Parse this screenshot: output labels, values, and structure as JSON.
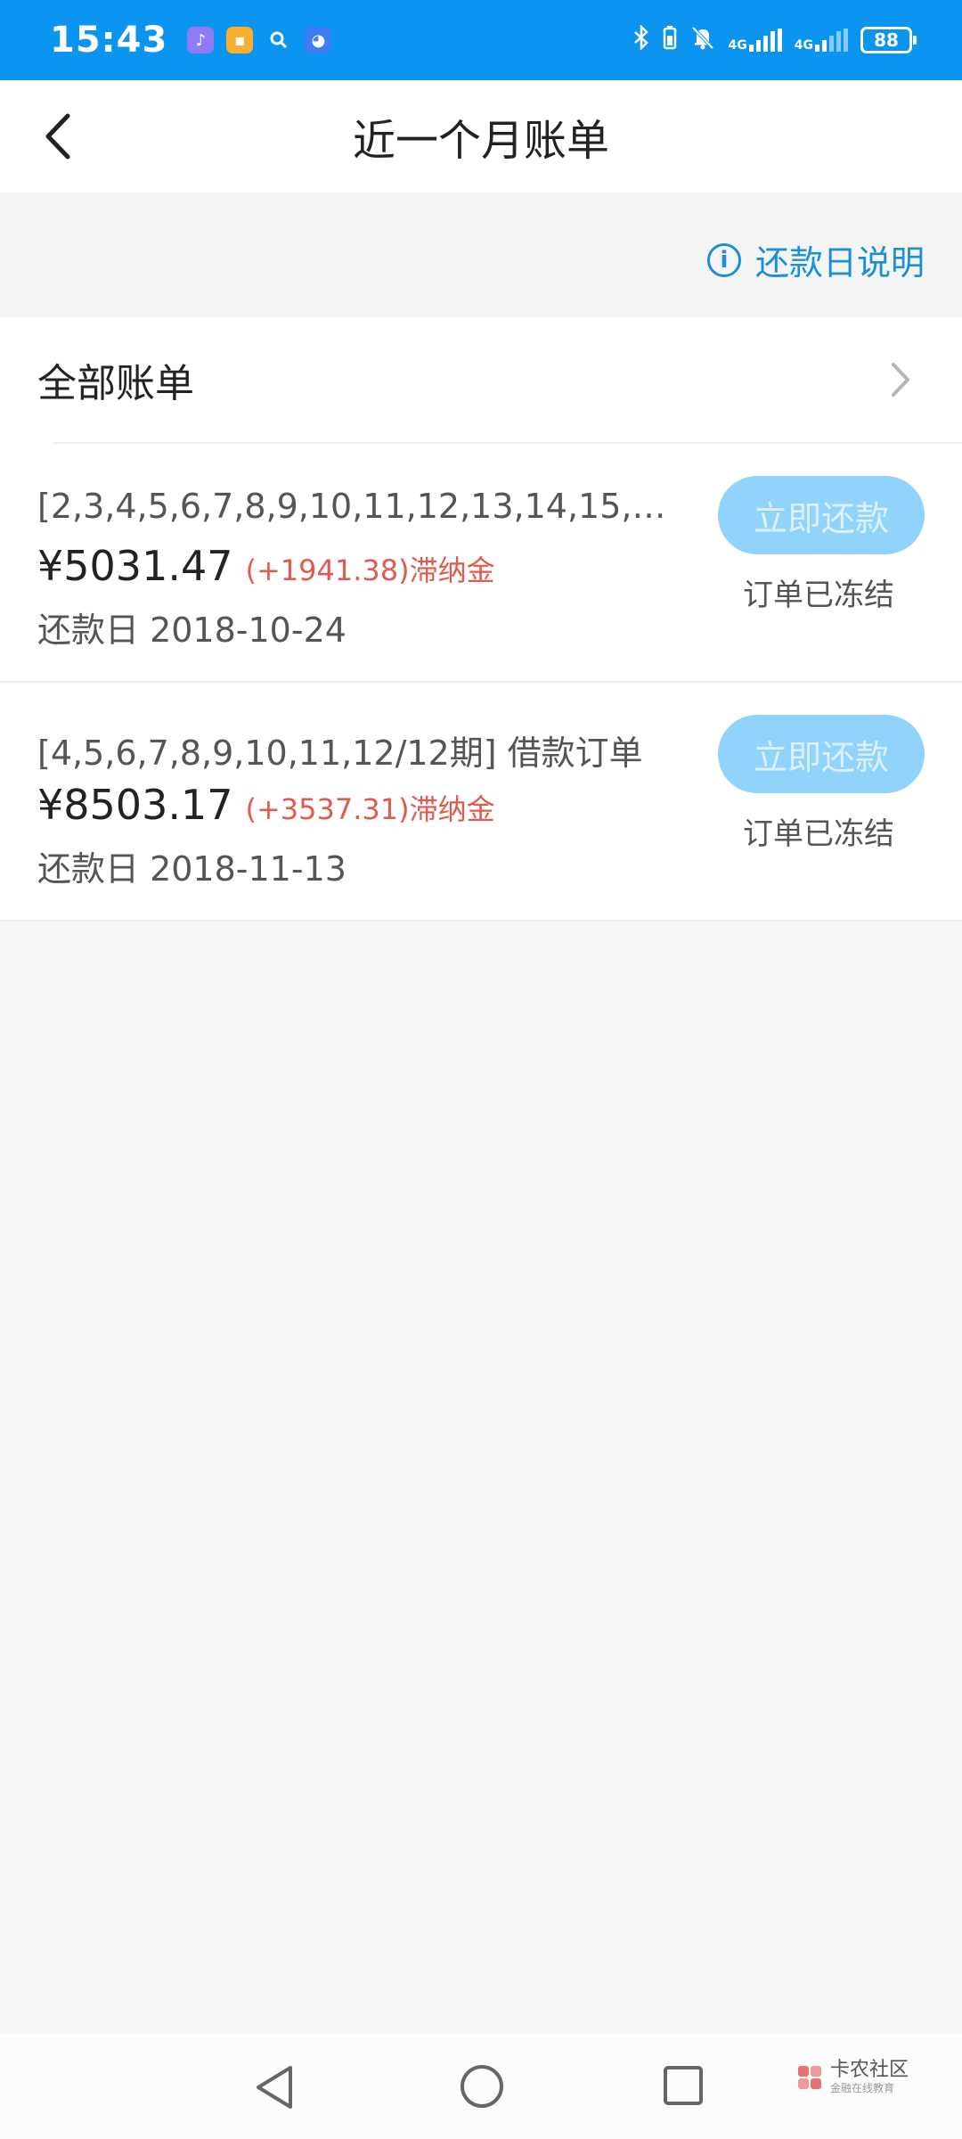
{
  "status_bar": {
    "time": "15:43",
    "network_1": "4G",
    "network_2": "4G",
    "battery": "88"
  },
  "header": {
    "title": "近一个月账单"
  },
  "info_link": {
    "label": "还款日说明"
  },
  "all_bills": {
    "label": "全部账单"
  },
  "bills": [
    {
      "title": "[2,3,4,5,6,7,8,9,10,11,12,13,14,15,16,17...",
      "amount": "¥5031.47",
      "late_fee": "(+1941.38)滞纳金",
      "due": "还款日 2018-10-24",
      "button": "立即还款",
      "status": "订单已冻结"
    },
    {
      "title": "[4,5,6,7,8,9,10,11,12/12期] 借款订单",
      "amount": "¥8503.17",
      "late_fee": "(+3537.31)滞纳金",
      "due": "还款日 2018-11-13",
      "button": "立即还款",
      "status": "订单已冻结"
    }
  ],
  "watermark": {
    "main": "卡农社区",
    "sub": "金融在线教育"
  },
  "colors": {
    "status_bar": "#0b95f0",
    "accent_link": "#1c8fd6",
    "late_fee": "#e05a4e",
    "disabled_button": "#91d3fb"
  }
}
